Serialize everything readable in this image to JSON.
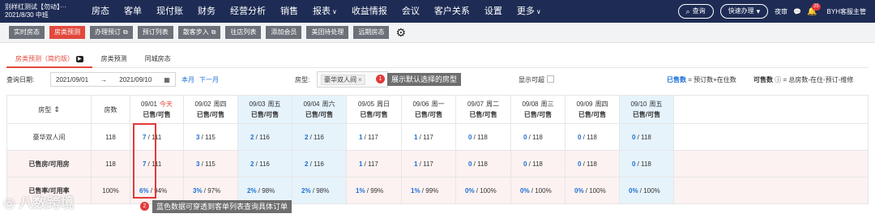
{
  "topbar": {
    "hotel_name": "别样红测试【勿动】···",
    "hotel_date": "2021/8/30 中班",
    "nav": [
      {
        "label": "房态"
      },
      {
        "label": "客单"
      },
      {
        "label": "现付账"
      },
      {
        "label": "财务"
      },
      {
        "label": "经营分析"
      },
      {
        "label": "销售"
      },
      {
        "label": "报表",
        "has_dropdown": true
      },
      {
        "label": "收益情报"
      },
      {
        "label": "会议"
      },
      {
        "label": "客户关系"
      },
      {
        "label": "设置"
      },
      {
        "label": "更多",
        "has_dropdown": true
      }
    ],
    "search_label": "查询",
    "quick_label": "快速办理",
    "night_audit": "夜审",
    "notification_count": "25",
    "user": "BYH客服主管"
  },
  "subtabs": [
    {
      "label": "实时房态",
      "active": false
    },
    {
      "label": "房类预测",
      "active": true
    },
    {
      "label": "办理预订",
      "active": false,
      "copy": true
    },
    {
      "label": "预订列表",
      "active": false
    },
    {
      "label": "散客步入",
      "active": false,
      "copy": true
    },
    {
      "label": "往店列表",
      "active": false
    },
    {
      "label": "添加会员",
      "active": false
    },
    {
      "label": "美团待处理",
      "active": false
    },
    {
      "label": "远期房态",
      "active": false
    }
  ],
  "pagetabs": [
    {
      "label": "房类预测（简约版）",
      "active": true,
      "video": true
    },
    {
      "label": "房类预测",
      "active": false
    },
    {
      "label": "同城房态",
      "active": false
    }
  ],
  "filters": {
    "date_label": "查询日期:",
    "date_from": "2021/09/01",
    "date_sep": "→",
    "date_to": "2021/09/10",
    "this_month": "本月",
    "next_month": "下一月",
    "roomtype_label": "房型:",
    "roomtype_tag": "豪华双人间",
    "show_unavailable": "显示可超",
    "sold_key": "已售数",
    "sold_def": "= 预订数+在住数",
    "avail_key": "可售数",
    "avail_def": "= 总房数-在住-预订-维修"
  },
  "annotations": {
    "a1_num": "1",
    "a1_text": "展示默认选择的房型",
    "a2_num": "2",
    "a2_text": "蓝色数据可穿透到客单列表查询具体订单"
  },
  "table": {
    "col_roomtype": "房型",
    "col_count": "房数",
    "sub_header": "已售/可售",
    "dates": [
      {
        "date": "09/01",
        "weekday": "今天",
        "today": true
      },
      {
        "date": "09/02",
        "weekday": "周四"
      },
      {
        "date": "09/03",
        "weekday": "周五",
        "highlight": true
      },
      {
        "date": "09/04",
        "weekday": "周六",
        "highlight": true
      },
      {
        "date": "09/05",
        "weekday": "周日"
      },
      {
        "date": "09/06",
        "weekday": "周一"
      },
      {
        "date": "09/07",
        "weekday": "周二"
      },
      {
        "date": "09/08",
        "weekday": "周三"
      },
      {
        "date": "09/09",
        "weekday": "周四"
      },
      {
        "date": "09/10",
        "weekday": "周五",
        "highlight": true
      }
    ],
    "rows": [
      {
        "name": "豪华双人间",
        "count": "118",
        "cells": [
          {
            "sold": "7",
            "avail": "111"
          },
          {
            "sold": "3",
            "avail": "115"
          },
          {
            "sold": "2",
            "avail": "116"
          },
          {
            "sold": "2",
            "avail": "116"
          },
          {
            "sold": "1",
            "avail": "117"
          },
          {
            "sold": "1",
            "avail": "117"
          },
          {
            "sold": "0",
            "avail": "118"
          },
          {
            "sold": "0",
            "avail": "118"
          },
          {
            "sold": "0",
            "avail": "118"
          },
          {
            "sold": "0",
            "avail": "118"
          }
        ]
      },
      {
        "name": "已售房/可用房",
        "count": "118",
        "total": true,
        "cells": [
          {
            "sold": "7",
            "avail": "111"
          },
          {
            "sold": "3",
            "avail": "115"
          },
          {
            "sold": "2",
            "avail": "116"
          },
          {
            "sold": "2",
            "avail": "116"
          },
          {
            "sold": "1",
            "avail": "117"
          },
          {
            "sold": "1",
            "avail": "117"
          },
          {
            "sold": "0",
            "avail": "118"
          },
          {
            "sold": "0",
            "avail": "118"
          },
          {
            "sold": "0",
            "avail": "118"
          },
          {
            "sold": "0",
            "avail": "118"
          }
        ]
      },
      {
        "name": "已售率/可用率",
        "count": "100%",
        "total": true,
        "rate": true,
        "cells": [
          {
            "sold": "6%",
            "avail": "94%"
          },
          {
            "sold": "3%",
            "avail": "97%"
          },
          {
            "sold": "2%",
            "avail": "98%"
          },
          {
            "sold": "2%",
            "avail": "98%"
          },
          {
            "sold": "1%",
            "avail": "99%"
          },
          {
            "sold": "1%",
            "avail": "99%"
          },
          {
            "sold": "0%",
            "avail": "100%"
          },
          {
            "sold": "0%",
            "avail": "100%"
          },
          {
            "sold": "0%",
            "avail": "100%"
          },
          {
            "sold": "0%",
            "avail": "100%"
          }
        ]
      }
    ]
  },
  "watermark": "◎ 八数跨境"
}
